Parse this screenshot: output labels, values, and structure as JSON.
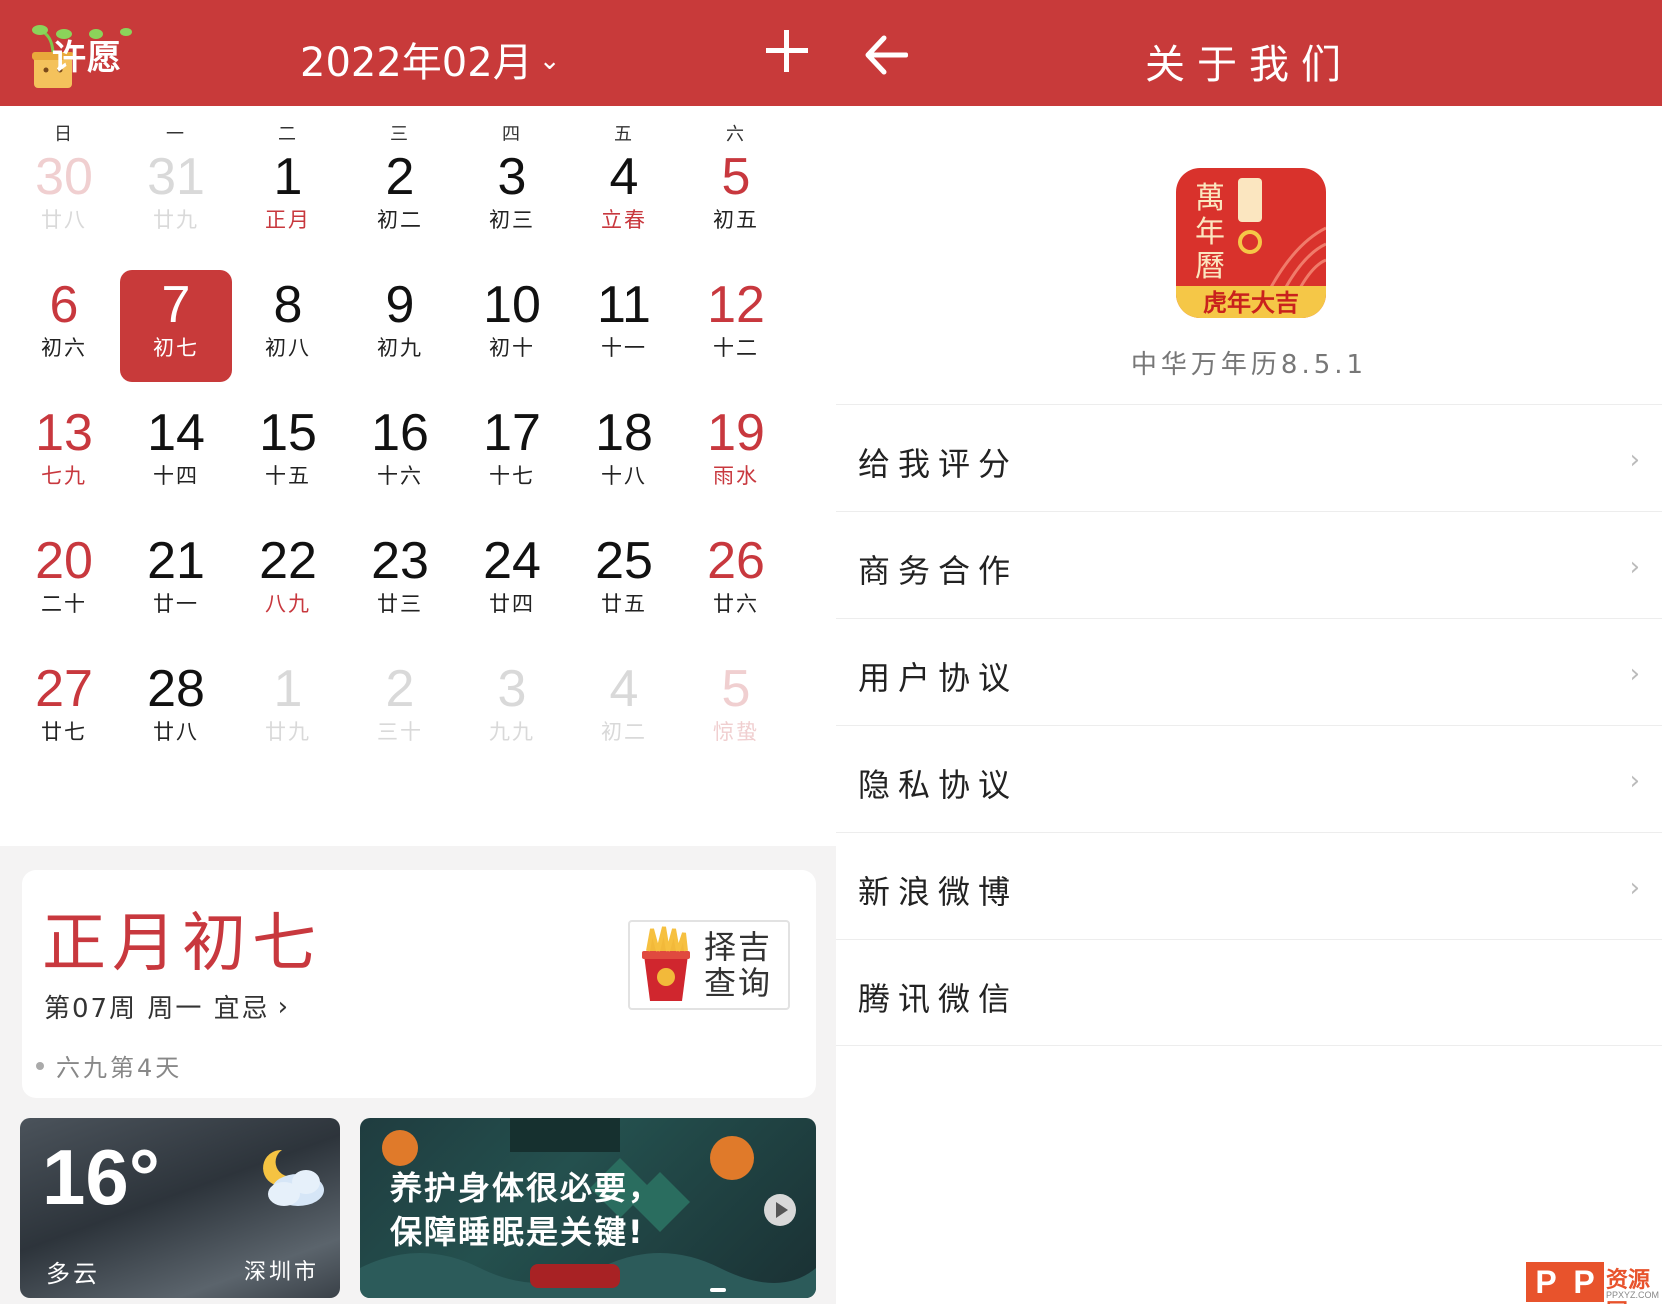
{
  "left": {
    "logo_text": "许愿",
    "month_title": "2022年02月",
    "weekdays": [
      "日",
      "一",
      "二",
      "三",
      "四",
      "五",
      "六"
    ],
    "days": [
      {
        "num": "30",
        "lunar": "廿八",
        "faded": true,
        "red": true,
        "lunar_red": false
      },
      {
        "num": "31",
        "lunar": "廿九",
        "faded": true,
        "red": false,
        "lunar_red": false
      },
      {
        "num": "1",
        "lunar": "正月",
        "faded": false,
        "red": false,
        "lunar_red": true
      },
      {
        "num": "2",
        "lunar": "初二",
        "faded": false,
        "red": false,
        "lunar_red": false
      },
      {
        "num": "3",
        "lunar": "初三",
        "faded": false,
        "red": false,
        "lunar_red": false
      },
      {
        "num": "4",
        "lunar": "立春",
        "faded": false,
        "red": false,
        "lunar_red": true
      },
      {
        "num": "5",
        "lunar": "初五",
        "faded": false,
        "red": true,
        "lunar_red": false
      },
      {
        "num": "6",
        "lunar": "初六",
        "faded": false,
        "red": true,
        "lunar_red": false
      },
      {
        "num": "7",
        "lunar": "初七",
        "faded": false,
        "red": false,
        "lunar_red": false,
        "selected": true
      },
      {
        "num": "8",
        "lunar": "初八",
        "faded": false,
        "red": false,
        "lunar_red": false
      },
      {
        "num": "9",
        "lunar": "初九",
        "faded": false,
        "red": false,
        "lunar_red": false
      },
      {
        "num": "10",
        "lunar": "初十",
        "faded": false,
        "red": false,
        "lunar_red": false
      },
      {
        "num": "11",
        "lunar": "十一",
        "faded": false,
        "red": false,
        "lunar_red": false
      },
      {
        "num": "12",
        "lunar": "十二",
        "faded": false,
        "red": true,
        "lunar_red": false
      },
      {
        "num": "13",
        "lunar": "七九",
        "faded": false,
        "red": true,
        "lunar_red": true
      },
      {
        "num": "14",
        "lunar": "十四",
        "faded": false,
        "red": false,
        "lunar_red": false
      },
      {
        "num": "15",
        "lunar": "十五",
        "faded": false,
        "red": false,
        "lunar_red": false
      },
      {
        "num": "16",
        "lunar": "十六",
        "faded": false,
        "red": false,
        "lunar_red": false
      },
      {
        "num": "17",
        "lunar": "十七",
        "faded": false,
        "red": false,
        "lunar_red": false
      },
      {
        "num": "18",
        "lunar": "十八",
        "faded": false,
        "red": false,
        "lunar_red": false
      },
      {
        "num": "19",
        "lunar": "雨水",
        "faded": false,
        "red": true,
        "lunar_red": true
      },
      {
        "num": "20",
        "lunar": "二十",
        "faded": false,
        "red": true,
        "lunar_red": false
      },
      {
        "num": "21",
        "lunar": "廿一",
        "faded": false,
        "red": false,
        "lunar_red": false
      },
      {
        "num": "22",
        "lunar": "八九",
        "faded": false,
        "red": false,
        "lunar_red": true
      },
      {
        "num": "23",
        "lunar": "廿三",
        "faded": false,
        "red": false,
        "lunar_red": false
      },
      {
        "num": "24",
        "lunar": "廿四",
        "faded": false,
        "red": false,
        "lunar_red": false
      },
      {
        "num": "25",
        "lunar": "廿五",
        "faded": false,
        "red": false,
        "lunar_red": false
      },
      {
        "num": "26",
        "lunar": "廿六",
        "faded": false,
        "red": true,
        "lunar_red": false
      },
      {
        "num": "27",
        "lunar": "廿七",
        "faded": false,
        "red": true,
        "lunar_red": false
      },
      {
        "num": "28",
        "lunar": "廿八",
        "faded": false,
        "red": false,
        "lunar_red": false
      },
      {
        "num": "1",
        "lunar": "廿九",
        "faded": true,
        "red": false,
        "lunar_red": false
      },
      {
        "num": "2",
        "lunar": "三十",
        "faded": true,
        "red": false,
        "lunar_red": false
      },
      {
        "num": "3",
        "lunar": "九九",
        "faded": true,
        "red": false,
        "lunar_red": false
      },
      {
        "num": "4",
        "lunar": "初二",
        "faded": true,
        "red": false,
        "lunar_red": false
      },
      {
        "num": "5",
        "lunar": "惊蛰",
        "faded": true,
        "red": true,
        "lunar_red": true
      }
    ],
    "info": {
      "lunar_date": "正月初七",
      "week_line": "第07周 周一 宜忌",
      "jiu_line": "六九第4天",
      "zeji_label": "择吉查询"
    },
    "weather": {
      "temp": "16°",
      "condition": "多云",
      "city": "深圳市",
      "icon": "partly-cloudy-night-icon"
    },
    "banner": {
      "line1": "养护身体很必要，",
      "line2": "保障睡眠是关键!"
    }
  },
  "right": {
    "title": "关于我们",
    "app_icon_text": "万年历",
    "app_icon_bottom": "虎年大吉",
    "version": "中华万年历8.5.1",
    "menu_items": [
      "给我评分",
      "商务合作",
      "用户协议",
      "隐私协议",
      "新浪微博",
      "腾讯微信"
    ],
    "chevron": "›"
  },
  "watermark": {
    "text": "资源网",
    "sub": "PPXYZ.COM"
  },
  "colors": {
    "brand_red": "#c83a3a",
    "holiday_red": "#c8383e"
  }
}
